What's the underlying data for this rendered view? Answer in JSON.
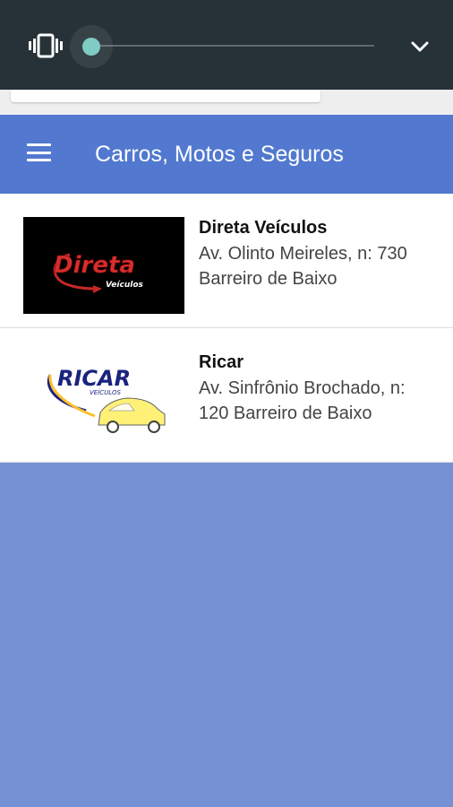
{
  "status_shade": {
    "vibrate_icon": "vibrate-icon",
    "volume_level": 0.0,
    "expand_icon": "chevron-down-icon"
  },
  "appbar": {
    "title": "Carros, Motos e Seguros",
    "menu_icon": "hamburger-menu-icon",
    "color": "#5279cf"
  },
  "list": {
    "items": [
      {
        "name": "Direta Veículos",
        "address": "Av. Olinto Meireles, n: 730 Barreiro de Baixo",
        "logo": {
          "text": "Direta",
          "subtext": "Veículos"
        }
      },
      {
        "name": "Ricar",
        "address": "Av. Sinfrônio Brochado, n: 120 Barreiro de Baixo",
        "logo": {
          "text": "RICAR",
          "subtext": "VEÍCULOS"
        }
      }
    ]
  },
  "colors": {
    "background": "#7591d4",
    "shade": "#263238",
    "accent_thumb": "#80cbc4"
  }
}
